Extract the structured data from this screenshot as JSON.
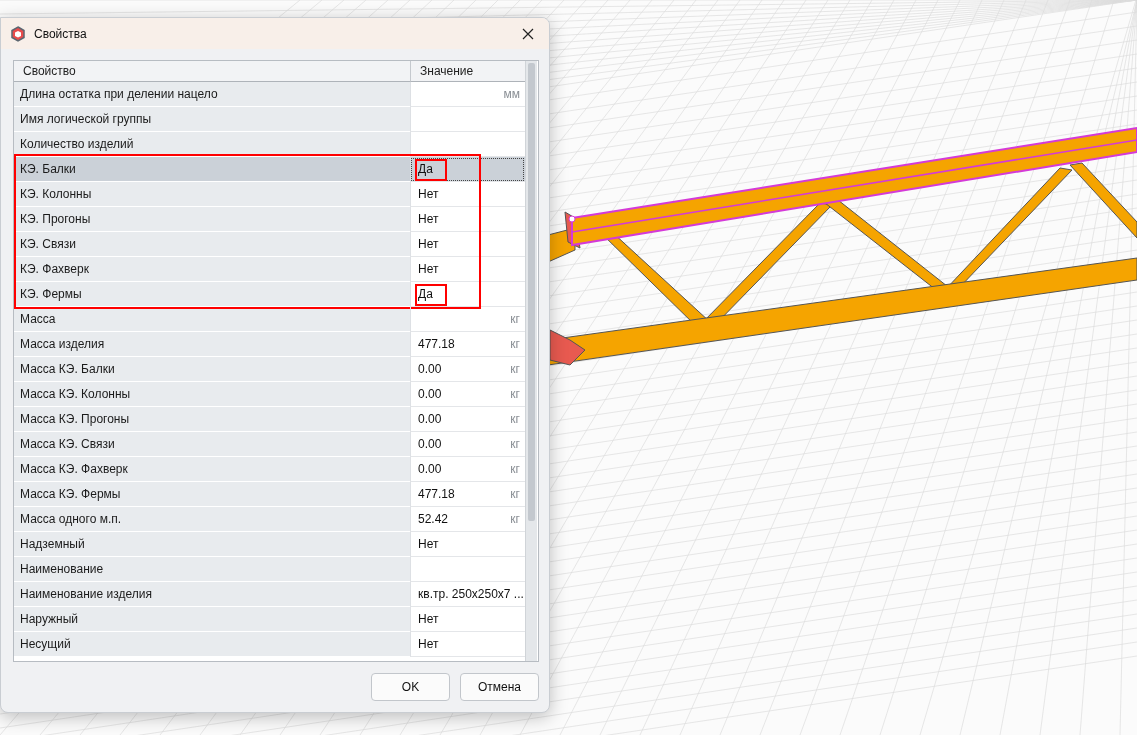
{
  "window": {
    "title": "Свойства"
  },
  "table": {
    "columns": [
      "Свойство",
      "Значение"
    ],
    "rows": [
      {
        "kind": "row",
        "property": "Длина остатка при делении нацело",
        "value": "",
        "unit": "мм",
        "selected": false
      },
      {
        "kind": "row",
        "property": "Имя логической группы",
        "value": "",
        "unit": "",
        "selected": false
      },
      {
        "kind": "row",
        "property": "Количество изделий",
        "value": "",
        "unit": "",
        "selected": false
      },
      {
        "kind": "framed_group",
        "rows": [
          {
            "property": "КЭ. Балки",
            "value": "Да",
            "unit": "",
            "selected": true,
            "value_framed": true
          },
          {
            "property": "КЭ. Колонны",
            "value": "Нет",
            "unit": "",
            "selected": false,
            "value_framed": false
          },
          {
            "property": "КЭ. Прогоны",
            "value": "Нет",
            "unit": "",
            "selected": false,
            "value_framed": false
          },
          {
            "property": "КЭ. Связи",
            "value": "Нет",
            "unit": "",
            "selected": false,
            "value_framed": false
          },
          {
            "property": "КЭ. Фахверк",
            "value": "Нет",
            "unit": "",
            "selected": false,
            "value_framed": false
          },
          {
            "property": "КЭ. Фермы",
            "value": "Да",
            "unit": "",
            "selected": false,
            "value_framed": true
          }
        ]
      },
      {
        "kind": "row",
        "property": "Масса",
        "value": "",
        "unit": "кг",
        "selected": false
      },
      {
        "kind": "row",
        "property": "Масса изделия",
        "value": "477.18",
        "unit": "кг",
        "selected": false
      },
      {
        "kind": "row",
        "property": "Масса КЭ. Балки",
        "value": "0.00",
        "unit": "кг",
        "selected": false
      },
      {
        "kind": "row",
        "property": "Масса КЭ. Колонны",
        "value": "0.00",
        "unit": "кг",
        "selected": false
      },
      {
        "kind": "row",
        "property": "Масса КЭ. Прогоны",
        "value": "0.00",
        "unit": "кг",
        "selected": false
      },
      {
        "kind": "row",
        "property": "Масса КЭ. Связи",
        "value": "0.00",
        "unit": "кг",
        "selected": false
      },
      {
        "kind": "row",
        "property": "Масса КЭ. Фахверк",
        "value": "0.00",
        "unit": "кг",
        "selected": false
      },
      {
        "kind": "row",
        "property": "Масса КЭ. Фермы",
        "value": "477.18",
        "unit": "кг",
        "selected": false
      },
      {
        "kind": "row",
        "property": "Масса одного м.п.",
        "value": "52.42",
        "unit": "кг",
        "selected": false
      },
      {
        "kind": "row",
        "property": "Надземный",
        "value": "Нет",
        "unit": "",
        "selected": false
      },
      {
        "kind": "row",
        "property": "Наименование",
        "value": "",
        "unit": "",
        "selected": false
      },
      {
        "kind": "row",
        "property": "Наименование изделия",
        "value": "кв.тр. 250x250x7 ...",
        "unit": "",
        "selected": false
      },
      {
        "kind": "row",
        "property": "Наружный",
        "value": "Нет",
        "unit": "",
        "selected": false
      },
      {
        "kind": "row",
        "property": "Несущий",
        "value": "Нет",
        "unit": "",
        "selected": false
      }
    ]
  },
  "buttons": [
    "OK",
    "Отмена"
  ]
}
